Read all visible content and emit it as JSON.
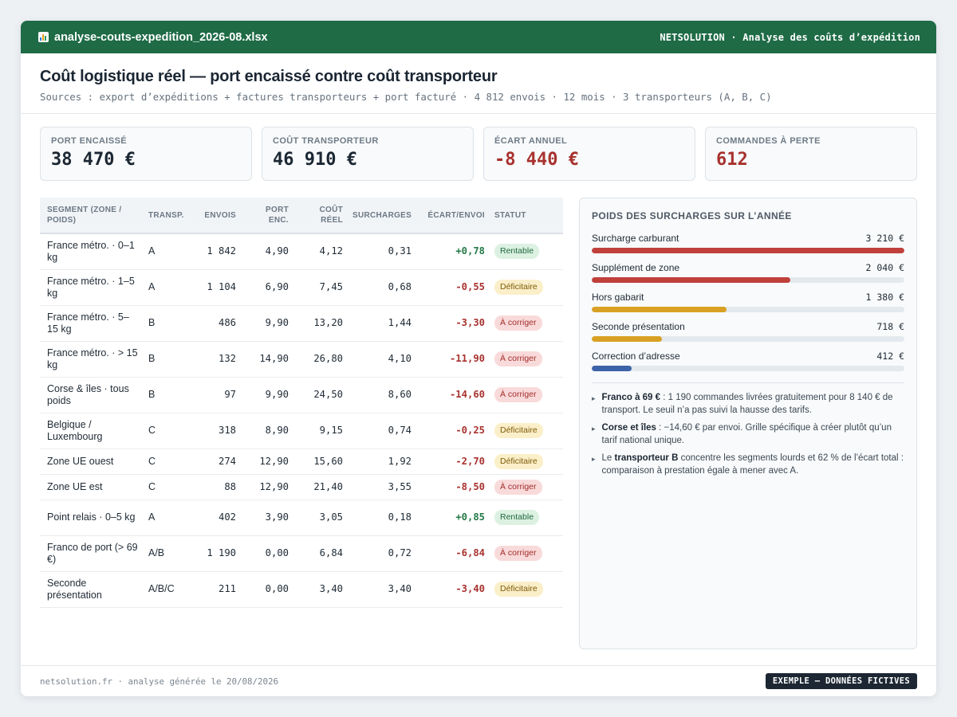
{
  "titlebar": {
    "filename": "analyse-couts-expedition_2026-08.xlsx",
    "app_label": "NETSOLUTION · Analyse des coûts d’expédition",
    "icon": "spreadsheet-chart-icon"
  },
  "header": {
    "title": "Coût logistique réel — port encaissé contre coût transporteur",
    "subtitle": "Sources : export d’expéditions + factures transporteurs + port facturé · 4 812 envois · 12 mois · 3 transporteurs (A, B, C)"
  },
  "kpis": [
    {
      "label": "PORT ENCAISSÉ",
      "value": "38 470 €",
      "tone": "normal"
    },
    {
      "label": "COÛT TRANSPORTEUR",
      "value": "46 910 €",
      "tone": "normal"
    },
    {
      "label": "ÉCART ANNUEL",
      "value": "-8 440 €",
      "tone": "negative"
    },
    {
      "label": "COMMANDES À PERTE",
      "value": "612",
      "tone": "negative"
    }
  ],
  "table": {
    "headers": [
      "SEGMENT (ZONE / POIDS)",
      "TRANSP.",
      "ENVOIS",
      "PORT ENC.",
      "COÛT RÉEL",
      "SURCHARGES",
      "ÉCART/ENVOI",
      "STATUT"
    ],
    "rows": [
      {
        "segment": "France métro. · 0–1 kg",
        "transp": "A",
        "envois": "1 842",
        "port": "4,90",
        "cout": "4,12",
        "surch": "0,31",
        "ecart": "+0,78",
        "statut": "Rentable"
      },
      {
        "segment": "France métro. · 1–5 kg",
        "transp": "A",
        "envois": "1 104",
        "port": "6,90",
        "cout": "7,45",
        "surch": "0,68",
        "ecart": "-0,55",
        "statut": "Déficitaire"
      },
      {
        "segment": "France métro. · 5–15 kg",
        "transp": "B",
        "envois": "486",
        "port": "9,90",
        "cout": "13,20",
        "surch": "1,44",
        "ecart": "-3,30",
        "statut": "À corriger"
      },
      {
        "segment": "France métro. · > 15 kg",
        "transp": "B",
        "envois": "132",
        "port": "14,90",
        "cout": "26,80",
        "surch": "4,10",
        "ecart": "-11,90",
        "statut": "À corriger"
      },
      {
        "segment": "Corse & îles · tous poids",
        "transp": "B",
        "envois": "97",
        "port": "9,90",
        "cout": "24,50",
        "surch": "8,60",
        "ecart": "-14,60",
        "statut": "À corriger"
      },
      {
        "segment": "Belgique / Luxembourg",
        "transp": "C",
        "envois": "318",
        "port": "8,90",
        "cout": "9,15",
        "surch": "0,74",
        "ecart": "-0,25",
        "statut": "Déficitaire"
      },
      {
        "segment": "Zone UE ouest",
        "transp": "C",
        "envois": "274",
        "port": "12,90",
        "cout": "15,60",
        "surch": "1,92",
        "ecart": "-2,70",
        "statut": "Déficitaire"
      },
      {
        "segment": "Zone UE est",
        "transp": "C",
        "envois": "88",
        "port": "12,90",
        "cout": "21,40",
        "surch": "3,55",
        "ecart": "-8,50",
        "statut": "À corriger"
      },
      {
        "segment": "Point relais · 0–5 kg",
        "transp": "A",
        "envois": "402",
        "port": "3,90",
        "cout": "3,05",
        "surch": "0,18",
        "ecart": "+0,85",
        "statut": "Rentable"
      },
      {
        "segment": "Franco de port (> 69 €)",
        "transp": "A/B",
        "envois": "1 190",
        "port": "0,00",
        "cout": "6,84",
        "surch": "0,72",
        "ecart": "-6,84",
        "statut": "À corriger"
      },
      {
        "segment": "Seconde présentation",
        "transp": "A/B/C",
        "envois": "211",
        "port": "0,00",
        "cout": "3,40",
        "surch": "3,40",
        "ecart": "-3,40",
        "statut": "Déficitaire"
      }
    ]
  },
  "surcharges": {
    "title": "POIDS DES SURCHARGES SUR L’ANNÉE",
    "max": 3210,
    "items": [
      {
        "label": "Surcharge carburant",
        "amount": "3 210 €",
        "value": 3210,
        "color": "#c0403c"
      },
      {
        "label": "Supplément de zone",
        "amount": "2 040 €",
        "value": 2040,
        "color": "#c0403c"
      },
      {
        "label": "Hors gabarit",
        "amount": "1 380 €",
        "value": 1380,
        "color": "#d9a123"
      },
      {
        "label": "Seconde présentation",
        "amount": "718 €",
        "value": 718,
        "color": "#d9a123"
      },
      {
        "label": "Correction d’adresse",
        "amount": "412 €",
        "value": 412,
        "color": "#3c63a8"
      }
    ],
    "notes": [
      {
        "pre": "",
        "bold": "Franco à 69 €",
        "post": " : 1 190 commandes livrées gratuitement pour 8 140 € de transport. Le seuil n’a pas suivi la hausse des tarifs."
      },
      {
        "pre": "",
        "bold": "Corse et îles",
        "post": " : −14,60 € par envoi. Grille spécifique à créer plutôt qu’un tarif national unique."
      },
      {
        "pre": "Le ",
        "bold": "transporteur B",
        "post": " concentre les segments lourds et 62 % de l’écart total : comparaison à prestation égale à mener avec A."
      }
    ]
  },
  "footer": {
    "left": "netsolution.fr · analyse générée le 20/08/2026",
    "tag": "EXEMPLE — DONNÉES FICTIVES"
  }
}
